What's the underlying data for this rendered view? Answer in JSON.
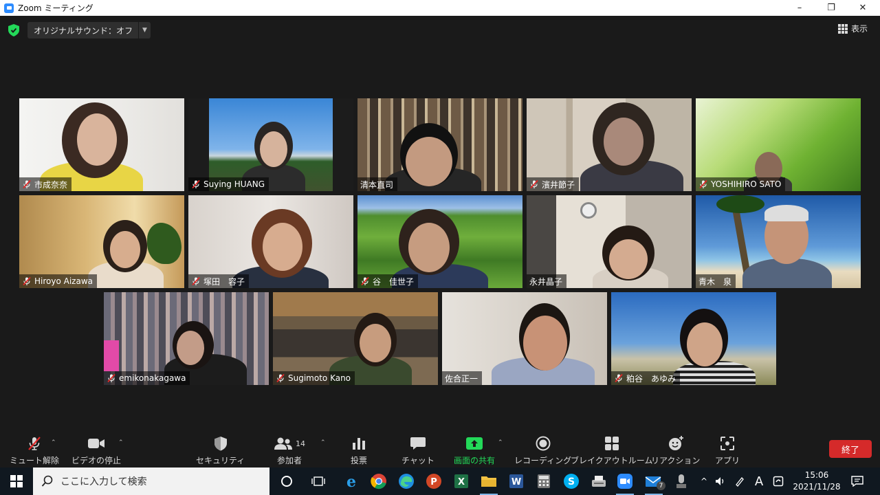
{
  "window": {
    "title": "Zoom ミーティング",
    "minimize": "–",
    "restore": "❐",
    "close": "✕"
  },
  "meeting": {
    "audio_status": "オリジナルサウンド：オフ",
    "view_label": "表示"
  },
  "participants": [
    {
      "name": "市成奈奈",
      "muted": true
    },
    {
      "name": "Suying HUANG",
      "muted": true
    },
    {
      "name": "清本直司",
      "muted": false
    },
    {
      "name": "濱井節子",
      "muted": true
    },
    {
      "name": "YOSHIHIRO SATO",
      "muted": true
    },
    {
      "name": "Hiroyo Aizawa",
      "muted": true
    },
    {
      "name": "塚田　容子",
      "muted": true
    },
    {
      "name": "谷　佳世子",
      "muted": true
    },
    {
      "name": "永井晶子",
      "muted": false
    },
    {
      "name": "青木　泉",
      "muted": false,
      "active_speaker": true
    },
    {
      "name": "emikonakagawa",
      "muted": true
    },
    {
      "name": "Sugimoto Kano",
      "muted": true
    },
    {
      "name": "佐合正一",
      "muted": false
    },
    {
      "name": "粕谷　あゆみ",
      "muted": true
    }
  ],
  "toolbar": {
    "mute": "ミュート解除",
    "video": "ビデオの停止",
    "security": "セキュリティ",
    "participants": "参加者",
    "participants_count": "14",
    "polls": "投票",
    "chat": "チャット",
    "share": "画面の共有",
    "record": "レコーディング",
    "breakout": "ブレイクアウトルーム",
    "reactions": "リアクション",
    "apps": "アプリ",
    "end": "終了"
  },
  "taskbar": {
    "search_placeholder": "ここに入力して検索",
    "time": "15:06",
    "date": "2021/11/28",
    "mail_badge": "7",
    "ime": "A"
  },
  "colors": {
    "accent_green": "#23d959",
    "end_red": "#d52a2a",
    "active_border": "#e8e85a",
    "zoom_blue": "#2d8cff"
  }
}
